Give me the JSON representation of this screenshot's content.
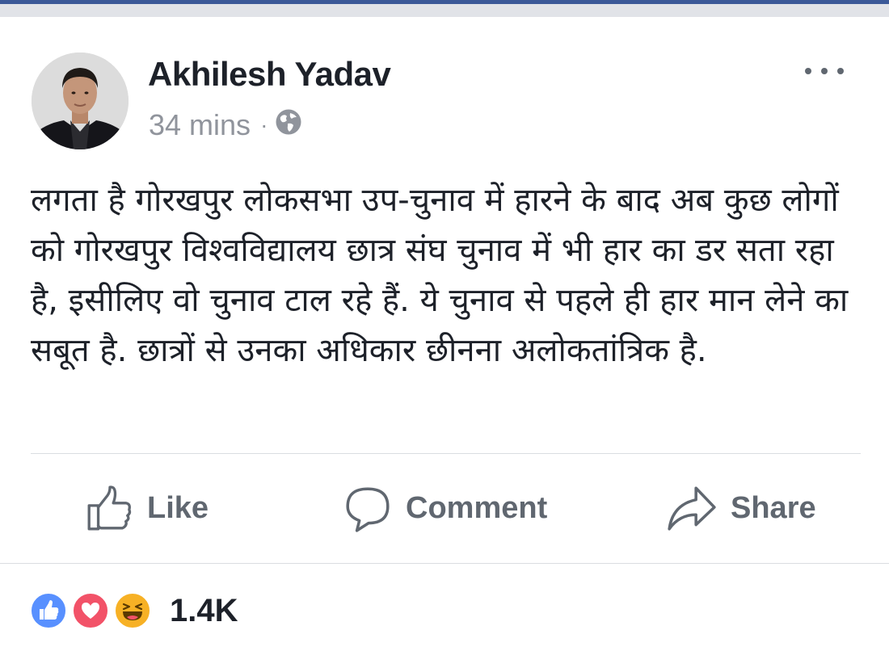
{
  "post": {
    "author": "Akhilesh Yadav",
    "time": "34 mins",
    "separator": "·",
    "privacy_icon": "globe-icon",
    "text": "लगता है गोरखपुर लोकसभा उप-चुनाव में हारने के बाद अब कुछ लोगों को गोरखपुर विश्वविद्यालय छात्र संघ चुनाव में भी हार का डर सता रहा है, इसीलिए वो चुनाव टाल रहे हैं. ये चुनाव से पहले ही हार मान लेने का सबूत है. छात्रों से उनका अधिकार छीनना अलोकतांत्रिक है."
  },
  "actions": {
    "like": "Like",
    "comment": "Comment",
    "share": "Share"
  },
  "reactions": {
    "types": [
      "like",
      "love",
      "haha"
    ],
    "count": "1.4K"
  },
  "colors": {
    "brand": "#3b5998",
    "text_primary": "#1d2129",
    "text_secondary": "#90949c",
    "action_text": "#606770",
    "like_reaction": "#5890ff",
    "love_reaction": "#f25268",
    "haha_reaction": "#f7b125"
  }
}
